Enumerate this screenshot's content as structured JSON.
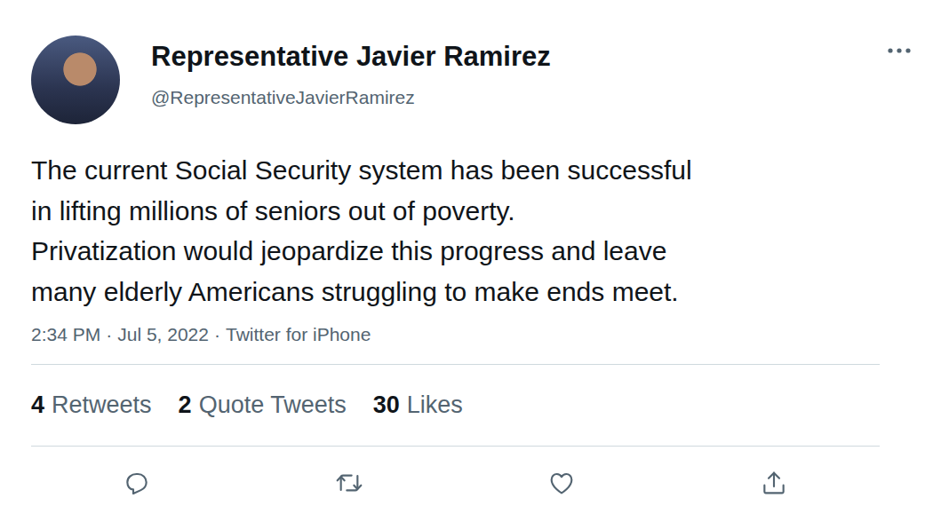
{
  "tweet": {
    "author": {
      "name": "Representative Javier Ramirez",
      "handle": "@RepresentativeJavierRamirez"
    },
    "text_lines": [
      "The current Social Security system has been successful",
      "in lifting millions of seniors out of poverty.",
      "Privatization would jeopardize this progress and leave",
      "many elderly Americans struggling to make ends meet."
    ],
    "meta": {
      "time": "2:34 PM",
      "separator": "·",
      "date": "Jul 5, 2022",
      "source": "Twitter for iPhone"
    },
    "stats": [
      {
        "count": "4",
        "label": "Retweets"
      },
      {
        "count": "2",
        "label": "Quote Tweets"
      },
      {
        "count": "30",
        "label": "Likes"
      }
    ]
  }
}
